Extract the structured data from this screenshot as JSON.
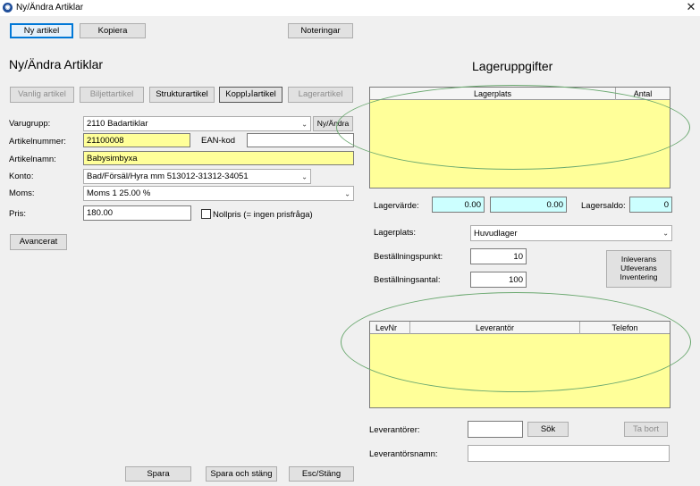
{
  "window": {
    "title": "Ny/Ändra Artiklar",
    "close_glyph": "✕"
  },
  "toolbar": {
    "new_article": "Ny artikel",
    "copy": "Kopiera",
    "notes": "Noteringar"
  },
  "left": {
    "heading": "Ny/Ändra Artiklar",
    "tabs": [
      "Vanlig artikel",
      "Biljettartikel",
      "Strukturartikel",
      "Kopplادartikel",
      "Lagerartikel"
    ],
    "fields": {
      "varugrupp_label": "Varugrupp:",
      "varugrupp_value": "2110 Badartiklar",
      "ny_andra": "Ny/Ändra",
      "artikelnummer_label": "Artikelnummer:",
      "artikelnummer_value": "21100008",
      "ean_label": "EAN-kod",
      "ean_value": "",
      "artikelnamn_label": "Artikelnamn:",
      "artikelnamn_value": "Babysimbyxa",
      "konto_label": "Konto:",
      "konto_value": "Bad/Försäl/Hyra mm 513012-31312-34051",
      "moms_label": "Moms:",
      "moms_value": "Moms 1 25.00 %",
      "pris_label": "Pris:",
      "pris_value": "180.00",
      "nollpris_label": "Nollpris (= ingen prisfråga)"
    },
    "advanced": "Avancerat"
  },
  "right": {
    "heading": "Lageruppgifter",
    "stock_grid": {
      "columns": [
        "Lagerplats",
        "Antal"
      ]
    },
    "lagervarde_label": "Lagervärde:",
    "lagervarde_1": "0.00",
    "lagervarde_2": "0.00",
    "lagersaldo_label": "Lagersaldo:",
    "lagersaldo_value": "0",
    "lagerplats_label": "Lagerplats:",
    "lagerplats_value": "Huvudlager",
    "bestallningspunkt_label": "Beställningspunkt:",
    "bestallningspunkt_value": "10",
    "bestallningsantal_label": "Beställningsantal:",
    "bestallningsantal_value": "100",
    "inout": {
      "line1": "Inleverans",
      "line2": "Utleverans",
      "line3": "Inventering"
    },
    "supplier_grid": {
      "columns": [
        "LevNr",
        "Leverantör",
        "Telefon"
      ]
    },
    "leverantorer_label": "Leverantörer:",
    "leverantorer_value": "",
    "sok": "Sök",
    "ta_bort": "Ta bort",
    "leverantorsnamn_label": "Leverantörsnamn:",
    "leverantorsnamn_value": ""
  },
  "footer": {
    "save": "Spara",
    "save_close": "Spara och stäng",
    "esc": "Esc/Stäng"
  },
  "colors": {
    "highlight_yellow": "#ffff99",
    "value_cyan": "#ccffff",
    "annotation_green": "#6aa86f",
    "focus_blue": "#0078d7"
  }
}
